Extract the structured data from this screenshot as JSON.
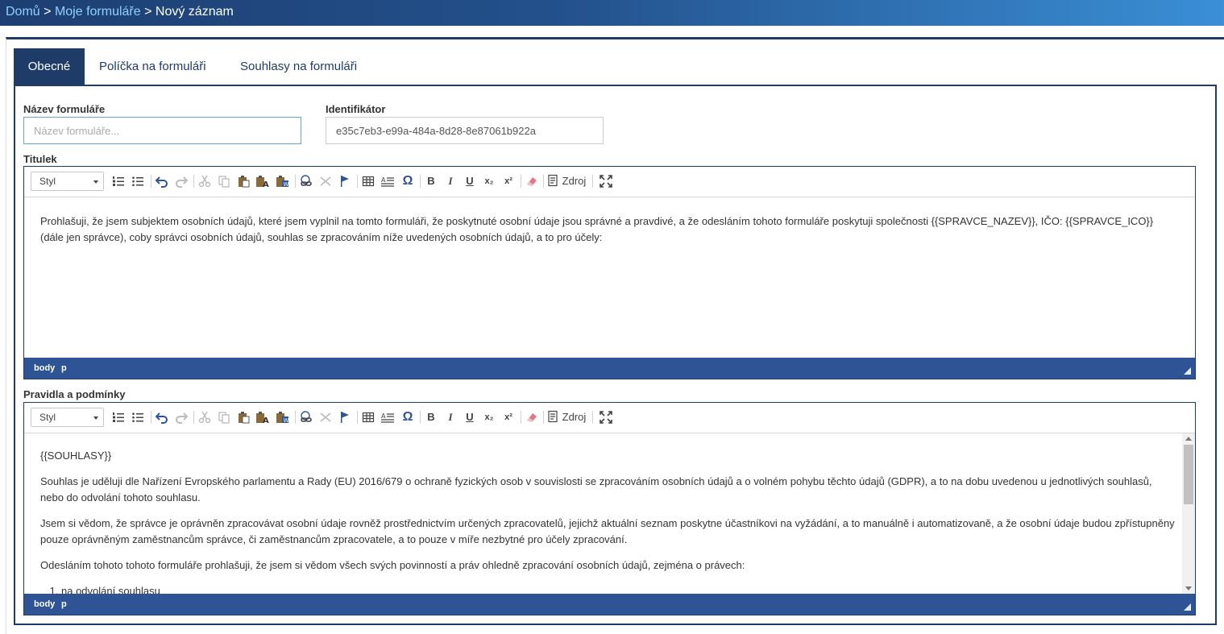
{
  "breadcrumb": {
    "home": "Domů",
    "forms": "Moje formuláře",
    "current": "Nový záznam",
    "separator": ">"
  },
  "colors": {
    "primary": "#1f3c68",
    "footer": "#2f5496",
    "link": "#8fd0ff"
  },
  "tabs": [
    {
      "label": "Obecné",
      "active": true
    },
    {
      "label": "Políčka na formuláři",
      "active": false
    },
    {
      "label": "Souhlasy na formuláři",
      "active": false
    }
  ],
  "form": {
    "name_label": "Název formuláře",
    "name_placeholder": "Název formuláře...",
    "name_value": "",
    "id_label": "Identifikátor",
    "id_value": "e35c7eb3-e99a-484a-8d28-8e87061b922a",
    "title_label": "Titulek",
    "rules_label": "Pravidla a podmínky"
  },
  "toolbar": {
    "style_combo": "Styl",
    "source_label": "Zdroj",
    "icons": [
      "numbered-list-icon",
      "bulleted-list-icon",
      "undo-icon",
      "redo-icon",
      "cut-icon",
      "copy-icon",
      "paste-icon",
      "paste-text-icon",
      "paste-word-icon",
      "link-icon",
      "unlink-icon",
      "anchor-icon",
      "table-icon",
      "spellcheck-icon",
      "special-char-icon",
      "bold-icon",
      "italic-icon",
      "underline-icon",
      "subscript-icon",
      "superscript-icon",
      "remove-format-icon",
      "source-icon",
      "maximize-icon"
    ],
    "glyphs": {
      "omega": "Ω",
      "bold": "B",
      "italic": "I",
      "underline": "U",
      "sub": "x₂",
      "sup": "x²"
    }
  },
  "editor_title": {
    "content": "Prohlašuji, že jsem subjektem osobních údajů, které jsem vyplnil na tomto formuláři, že poskytnuté osobní údaje jsou správné a pravdivé, a že odesláním tohoto formuláře poskytuji společnosti {{SPRAVCE_NAZEV}}, IČO: {{SPRAVCE_ICO}} (dále jen správce), coby správci osobních údajů, souhlas se zpracováním níže uvedených osobních údajů, a to pro účely:",
    "path": [
      "body",
      "p"
    ]
  },
  "editor_rules": {
    "paragraphs": [
      "{{SOUHLASY}}",
      "Souhlas je uděluji dle Nařízení  Evropského parlamentu a Rady (EU) 2016/679 o ochraně fyzických osob v souvislosti se zpracováním osobních údajů a o volném pohybu těchto údajů (GDPR), a to na dobu uvedenou u jednotlivých souhlasů, nebo do odvolání tohoto souhlasu.",
      "Jsem si vědom, že správce je oprávněn zpracovávat osobní údaje rovněž prostřednictvím určených zpracovatelů, jejichž aktuální seznam poskytne účastníkovi na vyžádání, a to manuálně i automatizovaně, a že osobní údaje budou zpřístupněny pouze oprávněným zaměstnancům správce, či zaměstnancům zpracovatele, a to pouze v míře nezbytné pro účely zpracování.",
      "Odesláním tohoto tohoto formuláře prohlašuji, že jsem si vědom všech svých povinností a práv ohledně zpracování osobních údajů, zejména o právech:"
    ],
    "list": [
      "na odvolání souhlasu"
    ],
    "path": [
      "body",
      "p"
    ]
  }
}
